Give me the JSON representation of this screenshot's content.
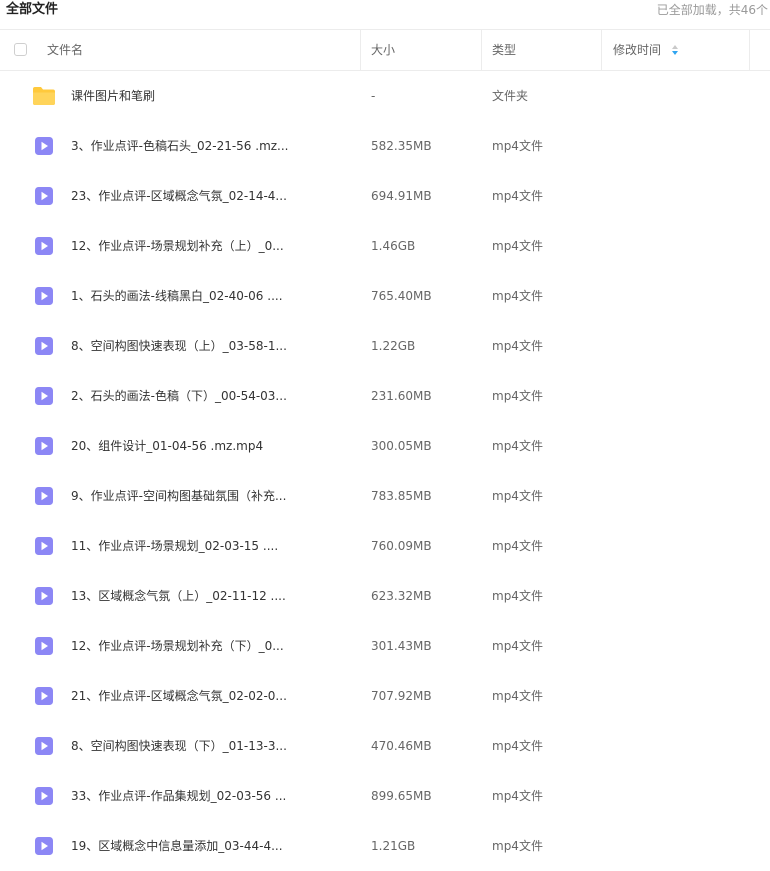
{
  "page": {
    "title": "全部文件",
    "status": "已全部加载，共46个"
  },
  "header": {
    "name_label": "文件名",
    "size_label": "大小",
    "type_label": "类型",
    "modified_label": "修改时间"
  },
  "colors": {
    "folder": "#FFC93C",
    "video": "#8C87F5",
    "sort_active": "#2FA4F0"
  },
  "files": [
    {
      "icon": "folder-icon",
      "name": "课件图片和笔刷",
      "size": "-",
      "type": "文件夹"
    },
    {
      "icon": "video-file-icon",
      "name": "3、作业点评-色稿石头_02-21-56 .mz...",
      "size": "582.35MB",
      "type": "mp4文件"
    },
    {
      "icon": "video-file-icon",
      "name": "23、作业点评-区域概念气氛_02-14-4...",
      "size": "694.91MB",
      "type": "mp4文件"
    },
    {
      "icon": "video-file-icon",
      "name": "12、作业点评-场景规划补充（上）_0...",
      "size": "1.46GB",
      "type": "mp4文件"
    },
    {
      "icon": "video-file-icon",
      "name": "1、石头的画法-线稿黑白_02-40-06 ....",
      "size": "765.40MB",
      "type": "mp4文件"
    },
    {
      "icon": "video-file-icon",
      "name": "8、空间构图快速表现（上）_03-58-1...",
      "size": "1.22GB",
      "type": "mp4文件"
    },
    {
      "icon": "video-file-icon",
      "name": "2、石头的画法-色稿（下）_00-54-03...",
      "size": "231.60MB",
      "type": "mp4文件"
    },
    {
      "icon": "video-file-icon",
      "name": "20、组件设计_01-04-56 .mz.mp4",
      "size": "300.05MB",
      "type": "mp4文件"
    },
    {
      "icon": "video-file-icon",
      "name": "9、作业点评-空间构图基础氛围（补充...",
      "size": "783.85MB",
      "type": "mp4文件"
    },
    {
      "icon": "video-file-icon",
      "name": "11、作业点评-场景规划_02-03-15 ....",
      "size": "760.09MB",
      "type": "mp4文件"
    },
    {
      "icon": "video-file-icon",
      "name": "13、区域概念气氛（上）_02-11-12 ....",
      "size": "623.32MB",
      "type": "mp4文件"
    },
    {
      "icon": "video-file-icon",
      "name": "12、作业点评-场景规划补充（下）_0...",
      "size": "301.43MB",
      "type": "mp4文件"
    },
    {
      "icon": "video-file-icon",
      "name": "21、作业点评-区域概念气氛_02-02-0...",
      "size": "707.92MB",
      "type": "mp4文件"
    },
    {
      "icon": "video-file-icon",
      "name": "8、空间构图快速表现（下）_01-13-3...",
      "size": "470.46MB",
      "type": "mp4文件"
    },
    {
      "icon": "video-file-icon",
      "name": "33、作业点评-作品集规划_02-03-56 ...",
      "size": "899.65MB",
      "type": "mp4文件"
    },
    {
      "icon": "video-file-icon",
      "name": "19、区域概念中信息量添加_03-44-4...",
      "size": "1.21GB",
      "type": "mp4文件"
    }
  ]
}
